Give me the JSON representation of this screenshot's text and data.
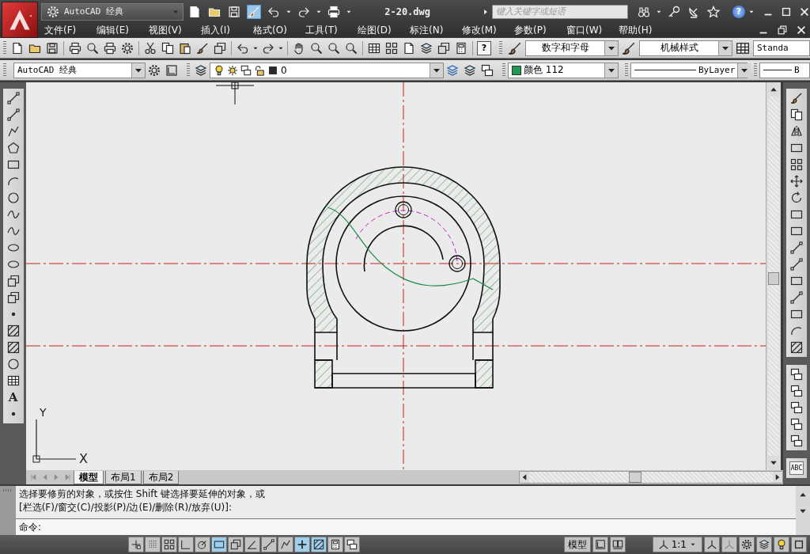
{
  "title_bar": {
    "workspace": "AutoCAD 经典",
    "file_name": "2-20.dwg",
    "search": {
      "placeholder": "键入关键字或短语"
    },
    "help_glyph": "?"
  },
  "menu": [
    "文件(F)",
    "编辑(E)",
    "视图(V)",
    "插入(I)",
    "格式(O)",
    "工具(T)",
    "绘图(D)",
    "标注(N)",
    "修改(M)",
    "参数(P)",
    "窗口(W)",
    "帮助(H)"
  ],
  "styles_toolbar": {
    "help_glyph": "?",
    "text_style": "数字和字母",
    "dimension_style": "机械样式",
    "table_style": "Standa"
  },
  "properties_toolbar": {
    "workspace": "AutoCAD 经典",
    "layer": "0",
    "color_label": "颜色 112",
    "linetype": "ByLayer",
    "lineweight": "B"
  },
  "draw_toolbar": {
    "text_tool_glyph": "A"
  },
  "modify_toolbar": {
    "text_tool_glyph": "ABC"
  },
  "ucs_icon": {
    "x_label": "X",
    "y_label": "Y"
  },
  "layout_tabs": [
    {
      "label": "模型",
      "selected": true
    },
    {
      "label": "布局1",
      "selected": false
    },
    {
      "label": "布局2",
      "selected": false
    }
  ],
  "command_line": {
    "history": [
      "选择要修剪的对象，或按住 Shift 键选择要延伸的对象，或",
      "[栏选(F)/窗交(C)/投影(P)/边(E)/删除(R)/放弃(U)]:"
    ],
    "prompt": "命令:"
  },
  "status_bar": {
    "toggles": [
      {
        "on": false
      },
      {
        "on": false
      },
      {
        "on": false
      },
      {
        "on": false
      },
      {
        "on": false
      },
      {
        "on": true
      },
      {
        "on": false
      },
      {
        "on": false
      },
      {
        "on": false
      },
      {
        "on": false
      },
      {
        "on": true
      },
      {
        "on": true
      },
      {
        "on": false
      },
      {
        "on": false
      }
    ],
    "space": "模型",
    "annotation_scale": "1:1"
  }
}
